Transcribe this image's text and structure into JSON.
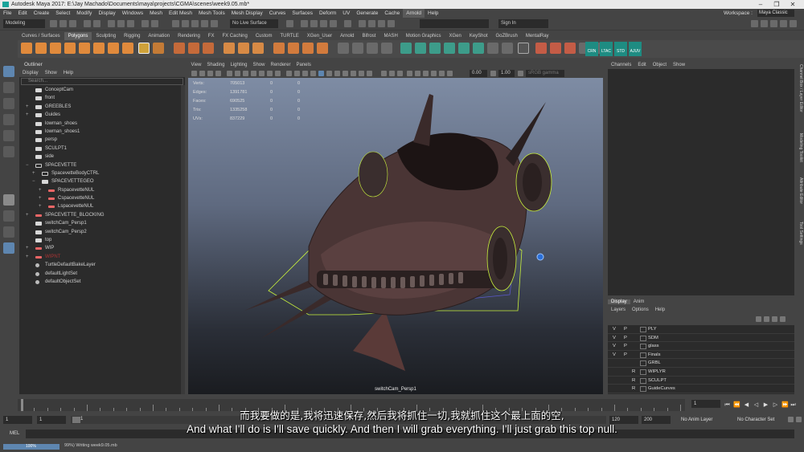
{
  "titlebar": {
    "title": "Autodesk Maya 2017: E:\\Jay Machado\\Documents\\maya\\projects\\CGMA\\scenes\\week9.05.mb*",
    "min": "–",
    "max": "❐",
    "close": "✕"
  },
  "menubar": {
    "items": [
      "File",
      "Edit",
      "Create",
      "Select",
      "Modify",
      "Display",
      "Windows",
      "Mesh",
      "Edit Mesh",
      "Mesh Tools",
      "Mesh Display",
      "Curves",
      "Surfaces",
      "Deform",
      "UV",
      "Generate",
      "Cache",
      "Arnold",
      "Help"
    ],
    "workspace_label": "Workspace :",
    "workspace_value": "Maya Classic"
  },
  "statusline": {
    "mode": "Modeling",
    "live_surface": "No Live Surface",
    "sign_in": "Sign In"
  },
  "shelf": {
    "tabs": [
      "Curves / Surfaces",
      "Polygons",
      "Sculpting",
      "Rigging",
      "Animation",
      "Rendering",
      "FX",
      "FX Caching",
      "Custom",
      "TURTLE",
      "XGen_User",
      "Arnold",
      "Bifrost",
      "MASH",
      "Motion Graphics",
      "XGen",
      "KeyShot",
      "GoZBrush",
      "MentalRay"
    ],
    "active_tab": "Polygons",
    "right_buttons": [
      "CRN",
      "LTAC",
      "STD",
      "AJUV"
    ]
  },
  "outliner": {
    "title": "Outliner",
    "menu": [
      "Display",
      "Show",
      "Help"
    ],
    "search_placeholder": "Search...",
    "items": [
      {
        "label": "ConceptCam",
        "indent": 0,
        "icon": "camera",
        "exp": ""
      },
      {
        "label": "front",
        "indent": 0,
        "icon": "camera",
        "exp": ""
      },
      {
        "label": "GREEBLES",
        "indent": 0,
        "icon": "group",
        "exp": "+"
      },
      {
        "label": "Guides",
        "indent": 0,
        "icon": "group",
        "exp": "+"
      },
      {
        "label": "lowman_shoes",
        "indent": 0,
        "icon": "mesh",
        "exp": ""
      },
      {
        "label": "lowman_shoes1",
        "indent": 0,
        "icon": "mesh",
        "exp": ""
      },
      {
        "label": "persp",
        "indent": 0,
        "icon": "camera",
        "exp": ""
      },
      {
        "label": "SCULPT1",
        "indent": 0,
        "icon": "mesh",
        "exp": ""
      },
      {
        "label": "side",
        "indent": 0,
        "icon": "camera",
        "exp": ""
      },
      {
        "label": "SPACEVETTE",
        "indent": 0,
        "icon": "curve",
        "exp": "−"
      },
      {
        "label": "SpacevetteBodyCTRL",
        "indent": 1,
        "icon": "curve",
        "exp": "+"
      },
      {
        "label": "SPACEVETTEGEO",
        "indent": 1,
        "icon": "group",
        "exp": "−"
      },
      {
        "label": "RspacevetteNUL",
        "indent": 2,
        "icon": "null",
        "exp": "+"
      },
      {
        "label": "CspacevetteNUL",
        "indent": 2,
        "icon": "null",
        "exp": "+"
      },
      {
        "label": "LspacevetteNUL",
        "indent": 2,
        "icon": "null",
        "exp": "+"
      },
      {
        "label": "SPACEVETTE_BLOCKING",
        "indent": 0,
        "icon": "null",
        "exp": "+"
      },
      {
        "label": "switchCam_Persp1",
        "indent": 0,
        "icon": "camera",
        "exp": ""
      },
      {
        "label": "switchCam_Persp2",
        "indent": 0,
        "icon": "camera",
        "exp": ""
      },
      {
        "label": "top",
        "indent": 0,
        "icon": "camera",
        "exp": ""
      },
      {
        "label": "WIP",
        "indent": 0,
        "icon": "null",
        "exp": "+"
      },
      {
        "label": "WIPNT",
        "indent": 0,
        "icon": "null",
        "exp": "+",
        "dim": true
      },
      {
        "label": "TurtleDefaultBakeLayer",
        "indent": 0,
        "icon": "set",
        "exp": ""
      },
      {
        "label": "defaultLightSet",
        "indent": 0,
        "icon": "set",
        "exp": ""
      },
      {
        "label": "defaultObjectSet",
        "indent": 0,
        "icon": "set",
        "exp": ""
      }
    ]
  },
  "viewport": {
    "menu": [
      "View",
      "Shading",
      "Lighting",
      "Show",
      "Renderer",
      "Panels"
    ],
    "exposure": "0.00",
    "gamma": "1.00",
    "color_space": "sRGB gamma",
    "hud": [
      {
        "label": "Verts:",
        "value": "705013",
        "c2": "0",
        "c3": "0"
      },
      {
        "label": "Edges:",
        "value": "1391781",
        "c2": "0",
        "c3": "0"
      },
      {
        "label": "Faces:",
        "value": "690525",
        "c2": "0",
        "c3": "0"
      },
      {
        "label": "Tris:",
        "value": "1335258",
        "c2": "0",
        "c3": "0"
      },
      {
        "label": "UVs:",
        "value": "837229",
        "c2": "0",
        "c3": "0"
      }
    ],
    "camera_name": "switchCam_Persp1"
  },
  "channelbox": {
    "menu": [
      "Channels",
      "Edit",
      "Object",
      "Show"
    ],
    "side_tabs": [
      "Channel Box / Layer Editor",
      "Modeling Toolkit",
      "Attribute Editor",
      "Tool Settings"
    ]
  },
  "layers": {
    "tabs": [
      "Display",
      "Anim"
    ],
    "active_tab": "Display",
    "menu": [
      "Layers",
      "Options",
      "Help"
    ],
    "rows": [
      {
        "v": "V",
        "p": "P",
        "name": "PLY"
      },
      {
        "v": "V",
        "p": "P",
        "name": "SDM"
      },
      {
        "v": "V",
        "p": "P",
        "name": "glass"
      },
      {
        "v": "V",
        "p": "P",
        "name": "Finals"
      },
      {
        "v": "",
        "p": "",
        "name": "GRBL"
      },
      {
        "v": "",
        "p": "R",
        "name": "WIPLYR"
      },
      {
        "v": "",
        "p": "R",
        "name": "SCULPT"
      },
      {
        "v": "",
        "p": "R",
        "name": "GuideCurves"
      }
    ]
  },
  "timeline": {
    "current_frame": "1",
    "range_start": "1",
    "range_inner_start": "1",
    "range_inner_end": "120",
    "range_end_a": "120",
    "range_end_b": "200",
    "anim_layer": "No Anim Layer",
    "char_set": "No Character Set"
  },
  "cmdline": {
    "label": "MEL"
  },
  "helpline": {
    "progress_percent": "100%",
    "progress_value": 1.0,
    "status": "99%) Writing week9.05.mb"
  },
  "subtitles": {
    "chinese": "而我要做的是,我将迅速保存,然后我将抓住一切,我就抓住这个最上面的空,",
    "english": "And what I'll do is I'll save quickly. And then I will grab everything. I'll just grab this top null."
  },
  "colors": {
    "accent_blue": "#5e86b0",
    "maya_teal": "#1aa39a",
    "selection_green": "#c8f03c"
  }
}
